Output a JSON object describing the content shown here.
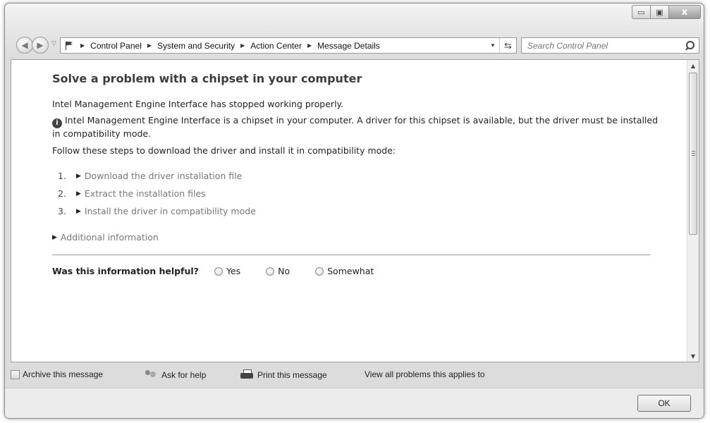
{
  "window": {
    "caption_buttons": {
      "minimize": "▭",
      "maximize": "▣",
      "close": "x"
    }
  },
  "nav": {
    "back_glyph": "◀",
    "forward_glyph": "▶",
    "history_glyph": "▽",
    "breadcrumb": [
      "Control Panel",
      "System and Security",
      "Action Center",
      "Message Details"
    ],
    "breadcrumb_separator": "▶",
    "address_dropdown_glyph": "▾",
    "refresh_glyph": "⇆",
    "search_placeholder": "Search Control Panel",
    "icons": [
      "flag-icon",
      "search-icon",
      "refresh-icon"
    ]
  },
  "content": {
    "title": "Solve a problem with a chipset in your computer",
    "problem_text": "Intel Management Engine Interface has stopped working properly.",
    "info_icon_glyph": "i",
    "info_text": "Intel Management Engine Interface is a chipset in your computer. A driver for this chipset is available, but the driver must be installed in compatibility mode.",
    "instructions": "Follow these steps to download the driver and install it in compatibility mode:",
    "steps": [
      {
        "num": "1.",
        "label": "Download the driver installation file"
      },
      {
        "num": "2.",
        "label": "Extract the installation files"
      },
      {
        "num": "3.",
        "label": "Install the driver in compatibility mode"
      }
    ],
    "expand_glyph": "▶",
    "additional_info": "Additional information",
    "helpful_question": "Was this information helpful?",
    "helpful_options": [
      "Yes",
      "No",
      "Somewhat"
    ]
  },
  "scrollbar": {
    "up_glyph": "▲",
    "down_glyph": "▼"
  },
  "bottom_links": {
    "archive": "Archive this message",
    "ask_help": "Ask for help",
    "print": "Print this message",
    "view_all": "View all problems this applies to"
  },
  "footer": {
    "ok": "OK"
  },
  "colors": {
    "link_gray": "#777777",
    "title": "#3c3c3c",
    "footer_bg": "#ececec"
  }
}
